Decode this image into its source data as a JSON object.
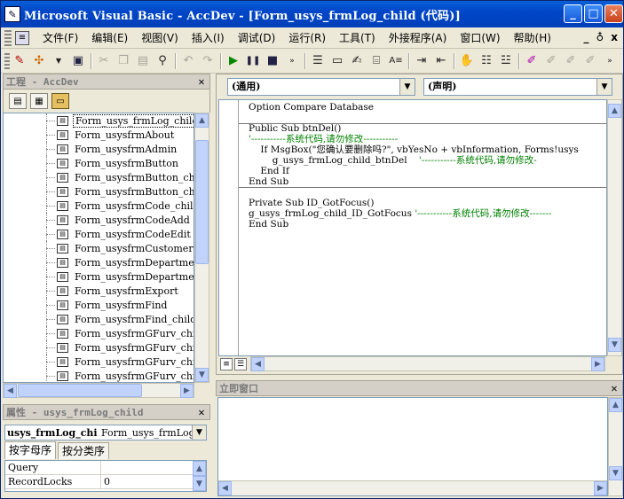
{
  "window": {
    "title": "Microsoft Visual Basic - AccDev - [Form_usys_frmLog_child (代码)]",
    "controls": {
      "minimize": "_",
      "maximize": "□",
      "close": "✕"
    }
  },
  "menubar": {
    "items": [
      "文件(F)",
      "编辑(E)",
      "视图(V)",
      "插入(I)",
      "调试(D)",
      "运行(R)",
      "工具(T)",
      "外接程序(A)",
      "窗口(W)",
      "帮助(H)"
    ],
    "mdi_controls": [
      "_",
      "♁",
      "x"
    ]
  },
  "project": {
    "title": "工程 - AccDev",
    "items": [
      "Form_usys_frmLog_child",
      "Form_usysfrmAbout",
      "Form_usysfrmAdmin",
      "Form_usysfrmButton",
      "Form_usysfrmButton_chil",
      "Form_usysfrmButton_chil",
      "Form_usysfrmCode_child",
      "Form_usysfrmCodeAdd",
      "Form_usysfrmCodeEdit",
      "Form_usysfrmCustomerInf",
      "Form_usysfrmDepartment_",
      "Form_usysfrmDepartment_",
      "Form_usysfrmExport",
      "Form_usysfrmFind",
      "Form_usysfrmFind_child",
      "Form_usysfrmGFurv_child",
      "Form_usysfrmGFurv_child",
      "Form_usysfrmGFurv_child",
      "Form_usysfrmGFurv_child"
    ],
    "selected_index": 0
  },
  "properties": {
    "title": "属性 - usys_frmLog_child",
    "object_name": "usys_frmLog_chi",
    "object_type": "Form_usys_frmLog_",
    "tabs": [
      "按字母序",
      "按分类序"
    ],
    "active_tab": 0,
    "rows": [
      {
        "key": "Query",
        "value": ""
      },
      {
        "key": "RecordLocks",
        "value": "0"
      }
    ]
  },
  "code": {
    "object_combo": "(通用)",
    "procedure_combo": "(声明)",
    "lines": [
      {
        "text": "Option Compare Database",
        "comment": ""
      },
      {
        "text": "",
        "comment": ""
      },
      {
        "text": "Public Sub btnDel()",
        "comment": ""
      },
      {
        "text": "",
        "comment": "'-----------系统代码,请勿修改-----------"
      },
      {
        "text": "    If MsgBox(\"您确认要删除吗?\", vbYesNo + vbInformation, Forms!usys",
        "comment": ""
      },
      {
        "text": "        g_usys_frmLog_child_btnDel    ",
        "comment": "'-----------系统代码,请勿修改-"
      },
      {
        "text": "    End If",
        "comment": ""
      },
      {
        "text": "End Sub",
        "comment": ""
      },
      {
        "text": "",
        "comment": ""
      },
      {
        "text": "Private Sub ID_GotFocus()",
        "comment": ""
      },
      {
        "text": "g_usys_frmLog_child_ID_GotFocus ",
        "comment": "'-----------系统代码,请勿修改-------"
      },
      {
        "text": "End Sub",
        "comment": ""
      }
    ]
  },
  "immediate": {
    "title": "立即窗口",
    "content": ""
  }
}
